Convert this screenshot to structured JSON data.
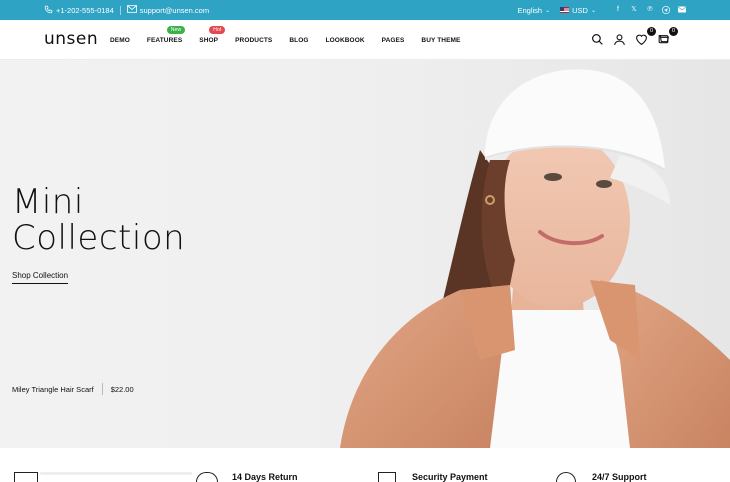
{
  "topbar": {
    "phone": "+1-202-555-0184",
    "email": "support@unsen.com",
    "language": "English",
    "currency": "USD",
    "social_icons": [
      "facebook-icon",
      "x-icon",
      "pinterest-icon",
      "telegram-icon",
      "mail-icon"
    ],
    "background": "#2fa3c4"
  },
  "header": {
    "logo": "unsen",
    "nav": [
      {
        "label": "DEMO"
      },
      {
        "label": "FEATURES",
        "badge": "New"
      },
      {
        "label": "SHOP",
        "badge": "Hot"
      },
      {
        "label": "PRODUCTS"
      },
      {
        "label": "BLOG"
      },
      {
        "label": "LOOKBOOK"
      },
      {
        "label": "PAGES"
      },
      {
        "label": "BUY THEME"
      }
    ],
    "wishlist_count": "0",
    "cart_count": "0"
  },
  "hero": {
    "title_line1": "Mini",
    "title_line2": "Collection",
    "cta": "Shop Collection",
    "product_name": "Miley Triangle Hair Scarf",
    "product_price": "$22.00"
  },
  "features": [
    {
      "label": "14 Days Return"
    },
    {
      "label": "Security Payment"
    },
    {
      "label": "24/7 Support"
    }
  ]
}
